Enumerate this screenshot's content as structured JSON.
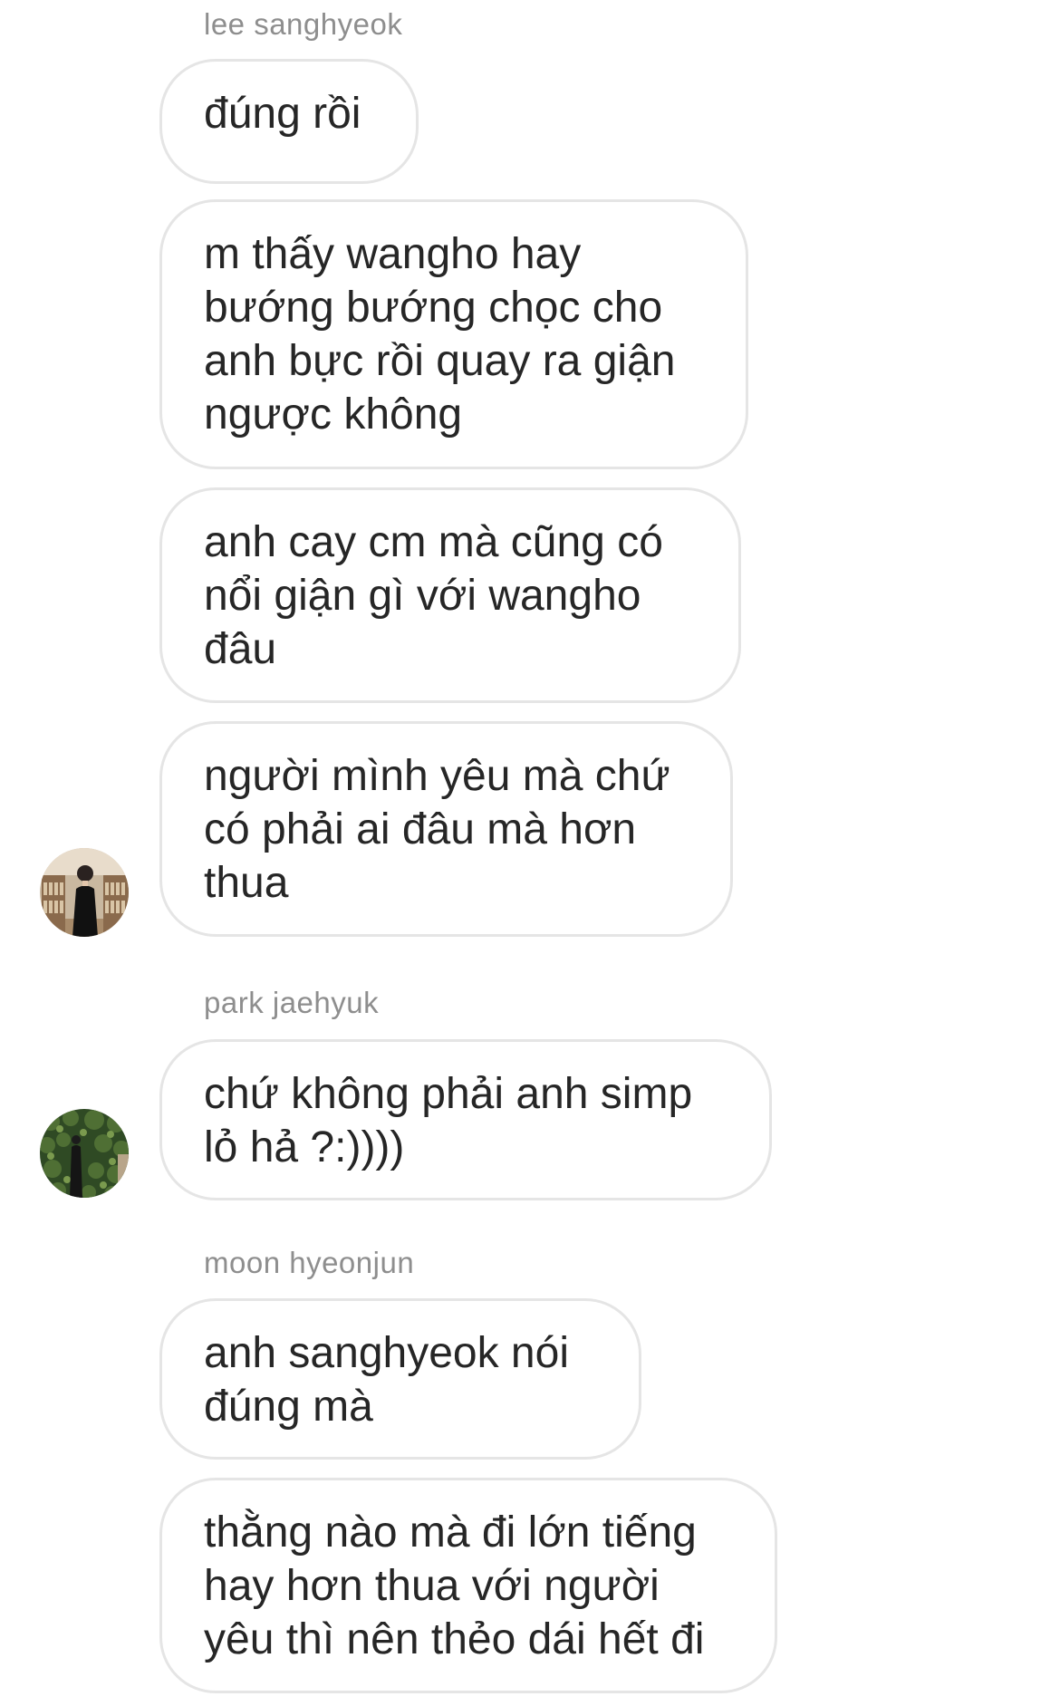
{
  "conversation": {
    "groups": [
      {
        "sender": "lee sanghyeok",
        "messages": [
          "đúng rồi",
          "m thấy wangho hay bướng bướng chọc cho anh bực rồi quay ra giận ngược không",
          "anh cay cm mà cũng có nổi giận gì với wangho đâu",
          "người mình yêu mà chứ có phải ai đâu mà hơn thua"
        ],
        "avatar_icon": "profile-photo-library"
      },
      {
        "sender": "park jaehyuk",
        "messages": [
          "chứ không phải anh simp lỏ hả ?:))))"
        ],
        "avatar_icon": "profile-photo-greenery"
      },
      {
        "sender": "moon hyeonjun",
        "messages": [
          "anh sanghyeok nói đúng mà",
          "thằng nào mà đi lớn tiếng hay hơn thua với người yêu thì nên thẻo dái hết đi"
        ]
      }
    ]
  },
  "colors": {
    "bubble_border": "#e5e5e5",
    "sender_text": "#8e8e8e",
    "message_text": "#262626",
    "background": "#ffffff"
  }
}
